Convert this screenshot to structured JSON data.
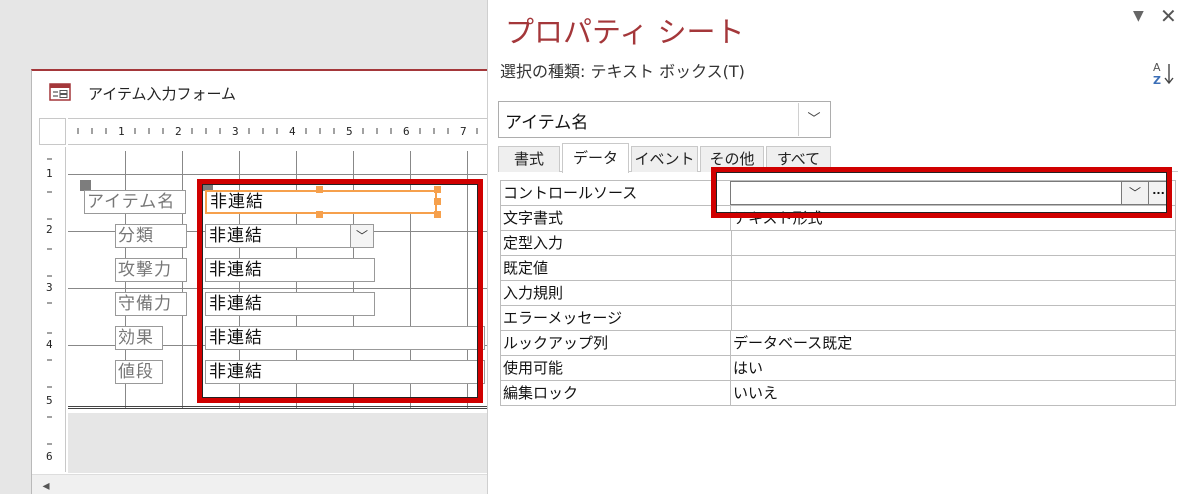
{
  "form_window": {
    "title": "アイテム入力フォーム",
    "ruler_h_numbers": [
      "1",
      "2",
      "3",
      "4",
      "5",
      "6",
      "7"
    ],
    "ruler_v_numbers": [
      "1",
      "2",
      "3",
      "4",
      "5",
      "6"
    ],
    "controls": [
      {
        "label": "アイテム名",
        "value": "非連結",
        "selected": true
      },
      {
        "label": "分類",
        "value": "非連結",
        "type": "combo"
      },
      {
        "label": "攻撃力",
        "value": "非連結"
      },
      {
        "label": "守備力",
        "value": "非連結"
      },
      {
        "label": "効果",
        "value": "非連結"
      },
      {
        "label": "値段",
        "value": "非連結"
      }
    ]
  },
  "property_sheet": {
    "title": "プロパティ シート",
    "selection_type": "選択の種類:  テキスト ボックス(T)",
    "object_select_value": "アイテム名",
    "tabs": [
      {
        "label": "書式",
        "active": false
      },
      {
        "label": "データ",
        "active": true
      },
      {
        "label": "イベント",
        "active": false
      },
      {
        "label": "その他",
        "active": false
      },
      {
        "label": "すべて",
        "active": false
      }
    ],
    "properties": [
      {
        "name": "コントロールソース",
        "value": ""
      },
      {
        "name": "文字書式",
        "value": "テキスト形式"
      },
      {
        "name": "定型入力",
        "value": ""
      },
      {
        "name": "既定値",
        "value": ""
      },
      {
        "name": "入力規則",
        "value": ""
      },
      {
        "name": "エラーメッセージ",
        "value": ""
      },
      {
        "name": "ルックアップ列",
        "value": "データベース既定"
      },
      {
        "name": "使用可能",
        "value": "はい"
      },
      {
        "name": "編集ロック",
        "value": "いいえ"
      }
    ],
    "builder_label": "...",
    "pin_glyph": "▼",
    "close_glyph": "✕"
  },
  "colors": {
    "accent": "#a4373a",
    "highlight_box": "#d00000",
    "selection_handle": "#f6a04c"
  }
}
